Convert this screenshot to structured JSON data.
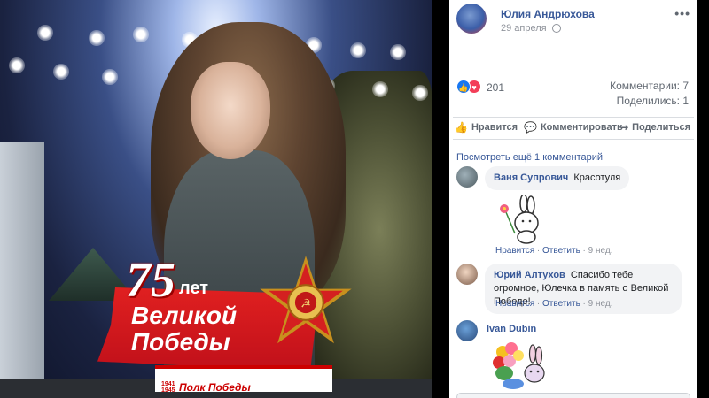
{
  "photo": {
    "badge": {
      "number": "75",
      "let": "лет",
      "line1": "Великой",
      "line2": "Победы",
      "year_start": "1941",
      "year_end": "1945",
      "campaign": "Полк Победы"
    }
  },
  "post": {
    "author": "Юлия Андрюхова",
    "date": "29 апреля",
    "privacy_icon": "globe-icon",
    "more_icon": "ellipsis-icon",
    "reactions": {
      "count": "201",
      "types": [
        "like-icon",
        "heart-icon"
      ],
      "comments_label": "Комментарии: 7",
      "shares_label": "Поделились: 1"
    },
    "actions": {
      "like": "Нравится",
      "comment": "Комментировать",
      "share": "Поделиться"
    },
    "view_more": "Посмотреть ещё 1 комментарий",
    "comments": [
      {
        "author": "Ваня Супрович",
        "text": "Красотуля",
        "has_sticker": true,
        "like": "Нравится",
        "reply": "Ответить",
        "time": "9 нед."
      },
      {
        "author": "Юрий Алтухов",
        "text": "Спасибо тебе огромное, Юлечка в память о Великой Победе!",
        "like": "Нравится",
        "reply": "Ответить",
        "time": "9 нед."
      },
      {
        "author": "Ivan Dubin",
        "text": "",
        "has_sticker": true
      }
    ]
  },
  "colors": {
    "link": "#385898",
    "muted": "#90949c",
    "like_blue": "#1877f2",
    "heart_red": "#f33e58",
    "badge_red": "#c0101a"
  }
}
